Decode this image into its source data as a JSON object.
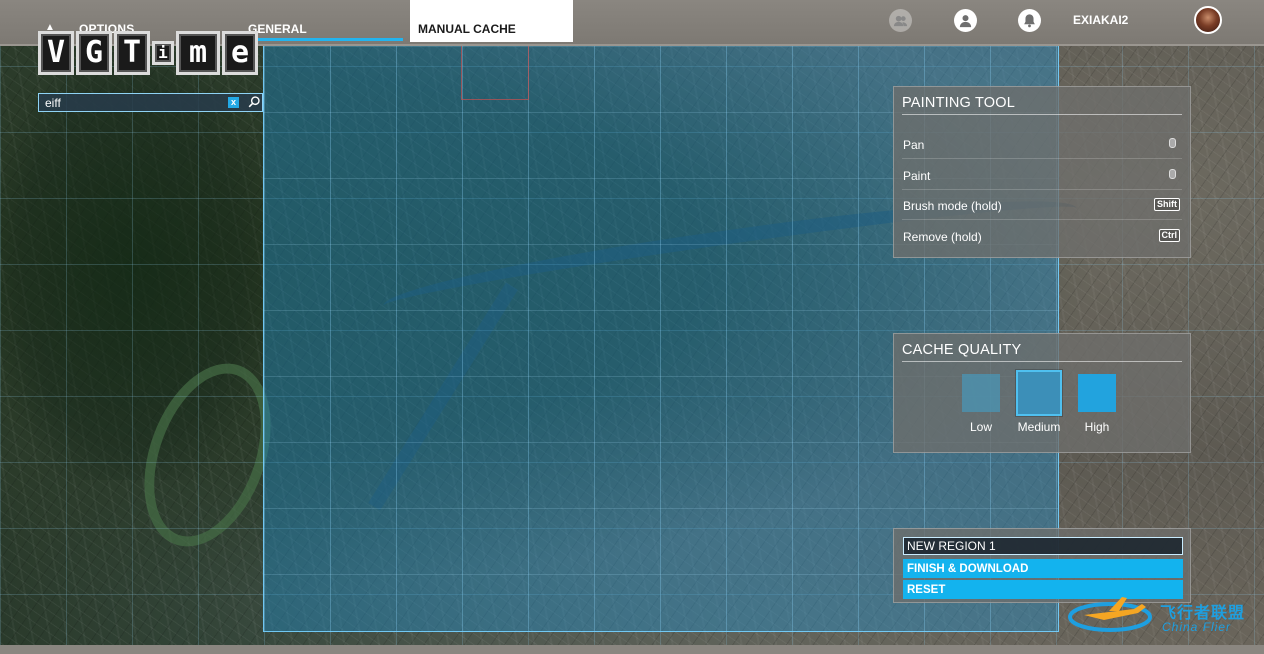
{
  "topbar": {
    "options_label": "OPTIONS",
    "tabs": [
      {
        "label": "GENERAL"
      },
      {
        "label": "MANUAL CACHE"
      }
    ],
    "user_name": "EXIAKAI2"
  },
  "logo": {
    "letters": [
      "V",
      "G",
      "T",
      "i",
      "m",
      "e"
    ]
  },
  "search": {
    "value": "eiff",
    "clear_label": "x"
  },
  "painting_tool": {
    "title": "PAINTING TOOL",
    "rows": [
      {
        "label": "Pan",
        "key": ""
      },
      {
        "label": "Paint",
        "key": ""
      },
      {
        "label": "Brush mode (hold)",
        "key": "Shift"
      },
      {
        "label": "Remove (hold)",
        "key": "Ctrl"
      }
    ]
  },
  "cache_quality": {
    "title": "CACHE QUALITY",
    "options": [
      {
        "label": "Low",
        "color": "#4a95b5"
      },
      {
        "label": "Medium",
        "color": "#3c8fb8"
      },
      {
        "label": "High",
        "color": "#22a3de"
      }
    ],
    "selected": "Medium"
  },
  "region_panel": {
    "name_value": "NEW REGION 1",
    "finish_label": "FINISH & DOWNLOAD",
    "reset_label": "RESET"
  },
  "watermark": {
    "cn": "飞行者联盟",
    "en": "China Flier"
  },
  "colors": {
    "accent": "#13b3ee",
    "region_fill": "#1e8cc8"
  }
}
